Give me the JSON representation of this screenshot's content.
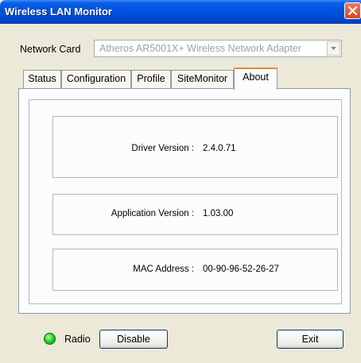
{
  "window": {
    "title": "Wireless LAN Monitor"
  },
  "network_card": {
    "label": "Network Card",
    "selected": "Atheros AR5001X+ Wireless Network Adapter"
  },
  "tabs": [
    {
      "label": "Status",
      "active": false
    },
    {
      "label": "Configuration",
      "active": false
    },
    {
      "label": "Profile",
      "active": false
    },
    {
      "label": "SiteMonitor",
      "active": false
    },
    {
      "label": "About",
      "active": true
    }
  ],
  "about": {
    "driver_version_label": "Driver Version :",
    "driver_version_value": "2.4.0.71",
    "app_version_label": "Application Version :",
    "app_version_value": "1.03.00",
    "mac_label": "MAC Address :",
    "mac_value": "00-90-96-52-26-27"
  },
  "footer": {
    "radio_label": "Radio",
    "radio_status_color": "#2bd62b",
    "disable_label": "Disable",
    "exit_label": "Exit"
  }
}
